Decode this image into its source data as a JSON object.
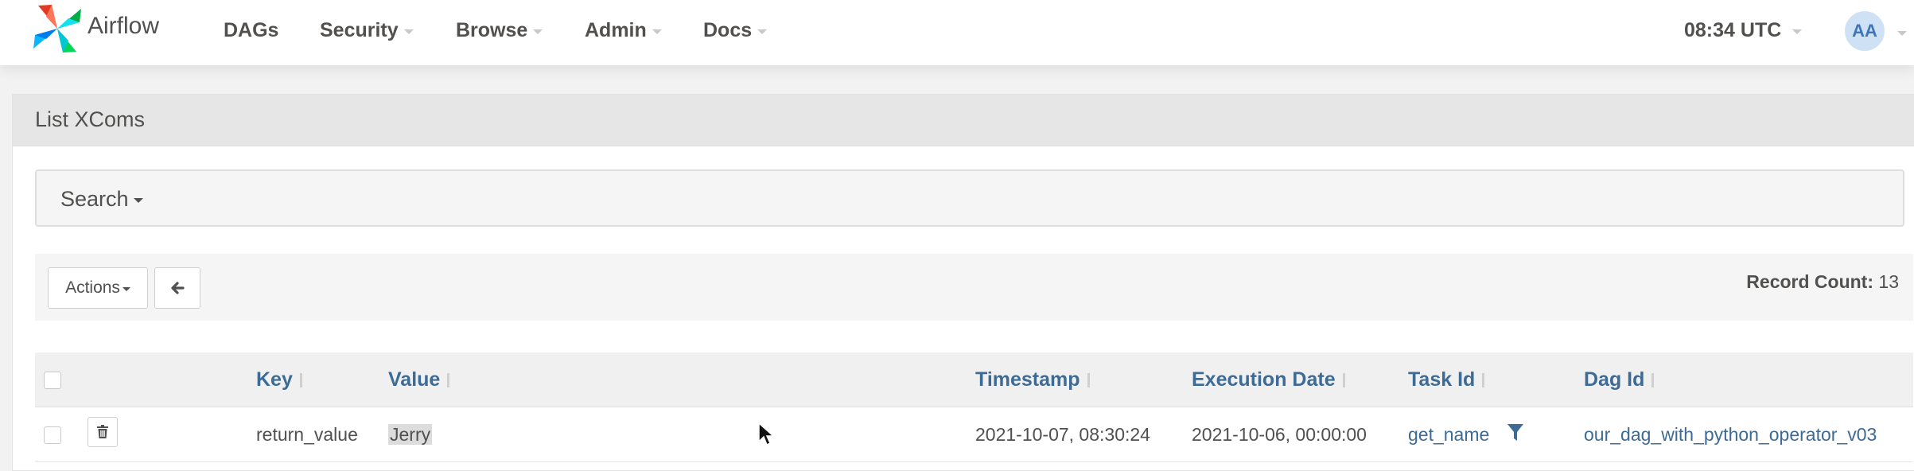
{
  "brand": {
    "name": "Airflow"
  },
  "nav": {
    "items": [
      {
        "label": "DAGs",
        "dropdown": false
      },
      {
        "label": "Security",
        "dropdown": true
      },
      {
        "label": "Browse",
        "dropdown": true
      },
      {
        "label": "Admin",
        "dropdown": true
      },
      {
        "label": "Docs",
        "dropdown": true
      }
    ],
    "clock": "08:34 UTC",
    "user_initials": "AA"
  },
  "panel": {
    "title": "List XComs",
    "search_label": "Search",
    "actions_label": "Actions",
    "record_count_label": "Record Count:",
    "record_count": "13"
  },
  "table": {
    "columns": [
      "Key",
      "Value",
      "Timestamp",
      "Execution Date",
      "Task Id",
      "Dag Id"
    ],
    "rows": [
      {
        "key": "return_value",
        "value": "Jerry",
        "timestamp": "2021-10-07, 08:30:24",
        "execution_date": "2021-10-06, 00:00:00",
        "task_id": "get_name",
        "dag_id": "our_dag_with_python_operator_v03"
      }
    ]
  },
  "icons": {
    "logo": "airflow-pinwheel-icon",
    "back": "arrow-left-icon",
    "delete": "trash-icon",
    "filter": "filter-icon",
    "sort": "sort-icon",
    "cursor": "mouse-pointer-icon"
  },
  "colors": {
    "link": "#3e6b95",
    "text": "#51504f",
    "avatar_bg": "#cfe2f5",
    "avatar_text": "#3d75b8"
  }
}
